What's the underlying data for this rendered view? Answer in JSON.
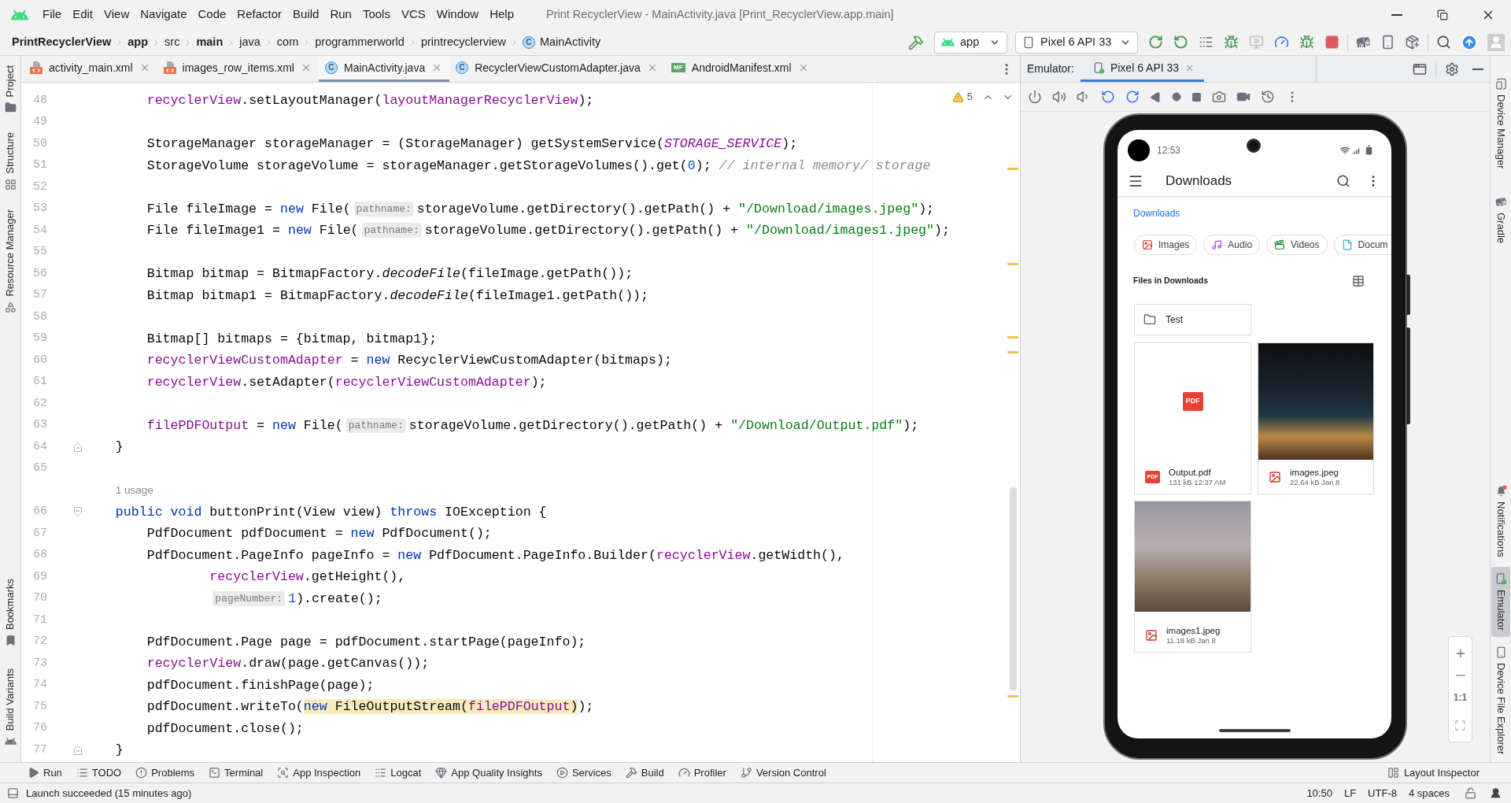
{
  "window": {
    "title": "Print RecyclerView - MainActivity.java [Print_RecyclerView.app.main]"
  },
  "menu": [
    "File",
    "Edit",
    "View",
    "Navigate",
    "Code",
    "Refactor",
    "Build",
    "Run",
    "Tools",
    "VCS",
    "Window",
    "Help"
  ],
  "breadcrumb": [
    {
      "label": "PrintRecyclerView",
      "bold": true
    },
    {
      "label": "app",
      "bold": true
    },
    {
      "label": "src",
      "bold": false
    },
    {
      "label": "main",
      "bold": true
    },
    {
      "label": "java",
      "bold": false
    },
    {
      "label": "com",
      "bold": false
    },
    {
      "label": "programmerworld",
      "bold": false
    },
    {
      "label": "printrecyclerview",
      "bold": false
    },
    {
      "label": "MainActivity",
      "bold": false,
      "icon_letter": "C"
    }
  ],
  "toolbar": {
    "run_config": "app",
    "device": "Pixel 6 API 33"
  },
  "left_strip": {
    "top": [
      {
        "label": "Project",
        "kind": "project",
        "selected": false
      },
      {
        "label": "Structure",
        "kind": "structure",
        "selected": false
      },
      {
        "label": "Resource Manager",
        "kind": "resources",
        "selected": false
      }
    ],
    "bottom": [
      {
        "label": "Bookmarks",
        "kind": "bookmarks",
        "selected": false
      },
      {
        "label": "Build Variants",
        "kind": "variants",
        "selected": false
      }
    ]
  },
  "editor": {
    "tabs": [
      {
        "label": "activity_main.xml",
        "kind": "xml",
        "selected": false
      },
      {
        "label": "images_row_items.xml",
        "kind": "xml",
        "selected": false
      },
      {
        "label": "MainActivity.java",
        "kind": "class",
        "icon_letter": "C",
        "selected": true
      },
      {
        "label": "RecyclerViewCustomAdapter.java",
        "kind": "class",
        "icon_letter": "C",
        "selected": false
      },
      {
        "label": "AndroidManifest.xml",
        "kind": "manifest",
        "icon_letter": "MF",
        "selected": false
      }
    ],
    "inspection_count": "5",
    "lines": [
      {
        "number": "48",
        "tokens": [
          {
            "text": "        recyclerView",
            "kind": "field"
          },
          {
            "text": ".setLayoutManager(",
            "kind": "plain"
          },
          {
            "text": "layoutManagerRecyclerView",
            "kind": "field"
          },
          {
            "text": ");",
            "kind": "plain"
          }
        ]
      },
      {
        "number": "49"
      },
      {
        "number": "50",
        "tokens": [
          {
            "text": "        StorageManager storageManager = (StorageManager) getSystemService(",
            "kind": "plain"
          },
          {
            "text": "STORAGE_SERVICE",
            "kind": "constant"
          },
          {
            "text": ");",
            "kind": "plain"
          }
        ]
      },
      {
        "number": "51",
        "tokens": [
          {
            "text": "        StorageVolume storageVolume = storageManager.getStorageVolumes().get(",
            "kind": "plain"
          },
          {
            "text": "0",
            "kind": "number"
          },
          {
            "text": "); ",
            "kind": "plain"
          },
          {
            "text": "// internal memory/ storage",
            "kind": "comment"
          }
        ]
      },
      {
        "number": "52"
      },
      {
        "number": "53",
        "tokens": [
          {
            "text": "        File fileImage = ",
            "kind": "plain"
          },
          {
            "text": "new",
            "kind": "keyword"
          },
          {
            "text": " File(",
            "kind": "plain"
          },
          {
            "text": "pathname:",
            "kind": "hint"
          },
          {
            "text": "storageVolume.getDirectory().getPath() + ",
            "kind": "plain"
          },
          {
            "text": "\"/Download/images.jpeg\"",
            "kind": "string"
          },
          {
            "text": ");",
            "kind": "plain"
          }
        ]
      },
      {
        "number": "54",
        "tokens": [
          {
            "text": "        File fileImage1 = ",
            "kind": "plain"
          },
          {
            "text": "new",
            "kind": "keyword"
          },
          {
            "text": " File(",
            "kind": "plain"
          },
          {
            "text": "pathname:",
            "kind": "hint"
          },
          {
            "text": "storageVolume.getDirectory().getPath() + ",
            "kind": "plain"
          },
          {
            "text": "\"/Download/images1.jpeg\"",
            "kind": "string"
          },
          {
            "text": ");",
            "kind": "plain"
          }
        ]
      },
      {
        "number": "55"
      },
      {
        "number": "56",
        "tokens": [
          {
            "text": "        Bitmap bitmap = BitmapFactory.",
            "kind": "plain"
          },
          {
            "text": "decodeFile",
            "kind": "static"
          },
          {
            "text": "(fileImage.getPath());",
            "kind": "plain"
          }
        ]
      },
      {
        "number": "57",
        "tokens": [
          {
            "text": "        Bitmap bitmap1 = BitmapFactory.",
            "kind": "plain"
          },
          {
            "text": "decodeFile",
            "kind": "static"
          },
          {
            "text": "(fileImage1.getPath());",
            "kind": "plain"
          }
        ]
      },
      {
        "number": "58"
      },
      {
        "number": "59",
        "tokens": [
          {
            "text": "        Bitmap[] bitmaps = {bitmap, bitmap1};",
            "kind": "plain"
          }
        ]
      },
      {
        "number": "60",
        "tokens": [
          {
            "text": "        recyclerViewCustomAdapter",
            "kind": "field"
          },
          {
            "text": " = ",
            "kind": "plain"
          },
          {
            "text": "new",
            "kind": "keyword"
          },
          {
            "text": " RecyclerViewCustomAdapter(bitmaps);",
            "kind": "plain"
          }
        ]
      },
      {
        "number": "61",
        "tokens": [
          {
            "text": "        recyclerView",
            "kind": "field"
          },
          {
            "text": ".setAdapter(",
            "kind": "plain"
          },
          {
            "text": "recyclerViewCustomAdapter",
            "kind": "field"
          },
          {
            "text": ");",
            "kind": "plain"
          }
        ]
      },
      {
        "number": "62"
      },
      {
        "number": "63",
        "tokens": [
          {
            "text": "        filePDFOutput",
            "kind": "field"
          },
          {
            "text": " = ",
            "kind": "plain"
          },
          {
            "text": "new",
            "kind": "keyword"
          },
          {
            "text": " File(",
            "kind": "plain"
          },
          {
            "text": "pathname:",
            "kind": "hint"
          },
          {
            "text": "storageVolume.getDirectory().getPath() + ",
            "kind": "plain"
          },
          {
            "text": "\"/Download/Output.pdf\"",
            "kind": "string"
          },
          {
            "text": ");",
            "kind": "plain"
          }
        ]
      },
      {
        "number": "64",
        "fold_end": true,
        "tokens": [
          {
            "text": "    }",
            "kind": "plain"
          }
        ]
      },
      {
        "number": "65"
      },
      {
        "number": "66",
        "fold_start": true,
        "usage": "1 usage",
        "tokens": [
          {
            "text": "    public void",
            "kind": "keyword"
          },
          {
            "text": " buttonPrint(View view) ",
            "kind": "plain"
          },
          {
            "text": "throws",
            "kind": "keyword"
          },
          {
            "text": " IOException {",
            "kind": "plain"
          }
        ]
      },
      {
        "number": "67",
        "tokens": [
          {
            "text": "        PdfDocument pdfDocument = ",
            "kind": "plain"
          },
          {
            "text": "new",
            "kind": "keyword"
          },
          {
            "text": " PdfDocument();",
            "kind": "plain"
          }
        ]
      },
      {
        "number": "68",
        "tokens": [
          {
            "text": "        PdfDocument.PageInfo pageInfo = ",
            "kind": "plain"
          },
          {
            "text": "new",
            "kind": "keyword"
          },
          {
            "text": " PdfDocument.PageInfo.Builder(",
            "kind": "plain"
          },
          {
            "text": "recyclerView",
            "kind": "field"
          },
          {
            "text": ".getWidth(),",
            "kind": "plain"
          }
        ]
      },
      {
        "number": "69",
        "tokens": [
          {
            "text": "                recyclerView",
            "kind": "field"
          },
          {
            "text": ".getHeight(),",
            "kind": "plain"
          }
        ]
      },
      {
        "number": "70",
        "tokens": [
          {
            "text": "                pageNumber:",
            "kind": "hint"
          },
          {
            "text": "1",
            "kind": "number"
          },
          {
            "text": ").create();",
            "kind": "plain"
          }
        ]
      },
      {
        "number": "71"
      },
      {
        "number": "72",
        "tokens": [
          {
            "text": "        PdfDocument.Page page = pdfDocument.startPage(pageInfo);",
            "kind": "plain"
          }
        ]
      },
      {
        "number": "73",
        "tokens": [
          {
            "text": "        recyclerView",
            "kind": "field"
          },
          {
            "text": ".draw(page.getCanvas());",
            "kind": "plain"
          }
        ]
      },
      {
        "number": "74",
        "tokens": [
          {
            "text": "        pdfDocument.finishPage(page);",
            "kind": "plain"
          }
        ]
      },
      {
        "number": "75",
        "tokens": [
          {
            "text": "        pdfDocument.writeTo(",
            "kind": "plain",
            "highlighted": false
          },
          {
            "text": "new",
            "kind": "keyword",
            "highlighted": true
          },
          {
            "text": " FileOutputStream(",
            "kind": "plain",
            "highlighted": true
          },
          {
            "text": "filePDFOutput",
            "kind": "field",
            "highlighted": true
          },
          {
            "text": ")",
            "kind": "plain",
            "highlighted": true
          },
          {
            "text": ");",
            "kind": "plain",
            "highlighted": false
          }
        ]
      },
      {
        "number": "76",
        "tokens": [
          {
            "text": "        pdfDocument.close();",
            "kind": "plain"
          }
        ]
      },
      {
        "number": "77",
        "fold_end": true,
        "tokens": [
          {
            "text": "    }",
            "kind": "plain"
          }
        ]
      }
    ]
  },
  "emulator": {
    "title": "Emulator:",
    "tabs": [
      {
        "label": "Pixel 6 API 33",
        "selected": true
      }
    ],
    "zoom_label": "1:1",
    "phone": {
      "time": "12:53",
      "title": "Downloads",
      "location": "Downloads",
      "chips": [
        {
          "label": "Images",
          "kind": "images"
        },
        {
          "label": "Audio",
          "kind": "audio"
        },
        {
          "label": "Videos",
          "kind": "videos"
        },
        {
          "label": "Docum",
          "kind": "documents"
        }
      ],
      "section_title": "Files in Downloads",
      "folders": [
        {
          "name": "Test"
        }
      ],
      "files": [
        {
          "name": "Output.pdf",
          "meta": "131 kB 12:37 AM",
          "kind": "pdf",
          "thumb_badge": "PDF",
          "icon_badge": "PDF"
        },
        {
          "name": "images.jpeg",
          "meta": "22.64 kB Jan 8",
          "kind": "image"
        },
        {
          "name": "images1.jpeg",
          "meta": "11.18 kB Jan 8",
          "kind": "image"
        }
      ]
    }
  },
  "right_strip": {
    "top": [
      {
        "label": "Device Manager",
        "kind": "devices",
        "selected": false
      },
      {
        "label": "Gradle",
        "kind": "gradle",
        "selected": false
      }
    ],
    "bottom": [
      {
        "label": "Notifications",
        "kind": "notifications",
        "selected": false
      },
      {
        "label": "Emulator",
        "kind": "emulator",
        "selected": true
      },
      {
        "label": "Device File Explorer",
        "kind": "files",
        "selected": false
      }
    ]
  },
  "tool_windows": {
    "left": [
      {
        "label": "Run",
        "kind": "run",
        "selected": false
      },
      {
        "label": "TODO",
        "kind": "todo",
        "selected": false
      },
      {
        "label": "Problems",
        "kind": "problems",
        "selected": false
      },
      {
        "label": "Terminal",
        "kind": "terminal",
        "selected": false
      },
      {
        "label": "App Inspection",
        "kind": "inspection",
        "selected": false
      },
      {
        "label": "Logcat",
        "kind": "logcat",
        "selected": false
      },
      {
        "label": "App Quality Insights",
        "kind": "quality",
        "selected": false
      },
      {
        "label": "Services",
        "kind": "services",
        "selected": false
      },
      {
        "label": "Build",
        "kind": "build",
        "selected": false
      },
      {
        "label": "Profiler",
        "kind": "profiler",
        "selected": false
      },
      {
        "label": "Version Control",
        "kind": "vcs",
        "selected": false
      }
    ],
    "right": [
      {
        "label": "Layout Inspector",
        "kind": "layout",
        "selected": false
      }
    ]
  },
  "status_bar": {
    "message": "Launch succeeded (15 minutes ago)",
    "items": [
      "10:50",
      "LF",
      "UTF-8",
      "4 spaces"
    ]
  }
}
